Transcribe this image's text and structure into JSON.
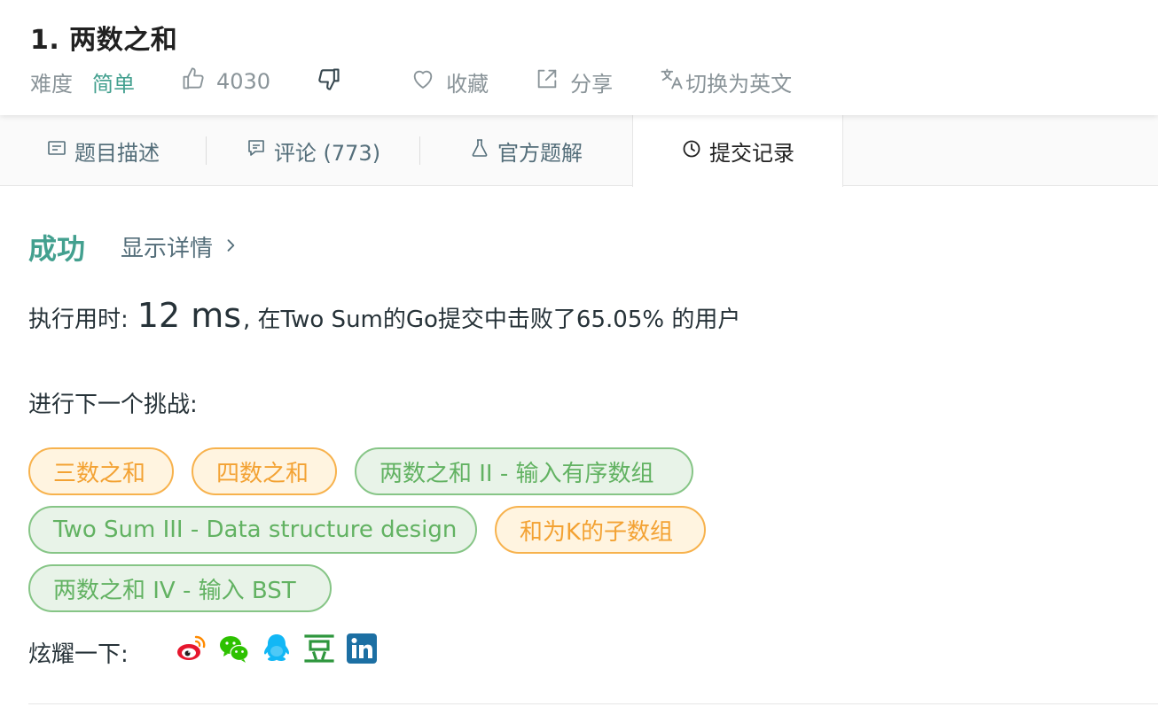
{
  "problem": {
    "title": "1. 两数之和",
    "difficulty_label": "难度",
    "difficulty_value": "简单",
    "likes": "4030",
    "favorite_label": "收藏",
    "share_label": "分享",
    "translate_label": "切换为英文"
  },
  "tabs": [
    {
      "label": "题目描述",
      "icon": "description-icon",
      "active": false
    },
    {
      "label": "评论 (773)",
      "icon": "comment-icon",
      "active": false
    },
    {
      "label": "官方题解",
      "icon": "flask-icon",
      "active": false
    },
    {
      "label": "提交记录",
      "icon": "clock-icon",
      "active": true
    }
  ],
  "result": {
    "status": "成功",
    "details_link": "显示详情",
    "runtime_prefix": "执行用时:",
    "runtime_value": "12 ms",
    "runtime_suffix": ", 在Two Sum的Go提交中击败了65.05% 的用户"
  },
  "next_challenge": {
    "label": "进行下一个挑战:",
    "items": [
      {
        "label": "三数之和",
        "color": "orange"
      },
      {
        "label": "四数之和",
        "color": "orange"
      },
      {
        "label": "两数之和 II - 输入有序数组",
        "color": "green"
      },
      {
        "label": "Two Sum III - Data structure design",
        "color": "green"
      },
      {
        "label": "和为K的子数组",
        "color": "orange"
      },
      {
        "label": "两数之和 IV - 输入 BST",
        "color": "green"
      }
    ]
  },
  "share": {
    "label": "炫耀一下:",
    "icons": [
      "weibo-icon",
      "wechat-icon",
      "qq-icon",
      "douban-icon",
      "linkedin-icon"
    ]
  },
  "colors": {
    "accent_green": "#43a08f",
    "chip_orange": "#f3a233",
    "chip_green": "#62b262"
  }
}
